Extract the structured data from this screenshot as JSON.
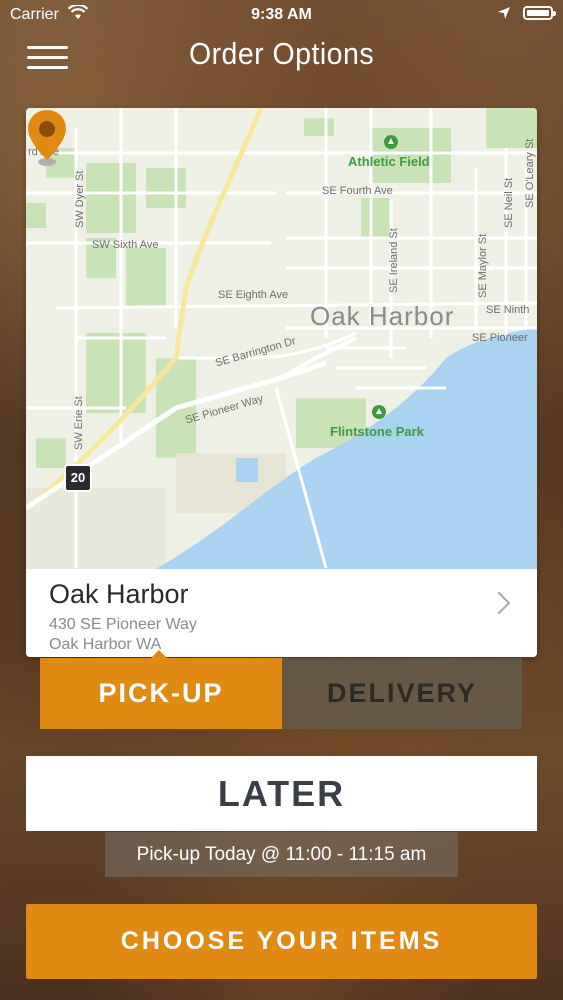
{
  "status_bar": {
    "carrier": "Carrier",
    "time": "9:38 AM",
    "battery_level": 0.95
  },
  "nav": {
    "title": "Order Options",
    "menu_icon": "hamburger-menu-icon"
  },
  "map": {
    "city_label": "Oak Harbor",
    "streets": [
      "rd Ave",
      "SW Dyer St",
      "SW Sixth Ave",
      "SE Fourth Ave",
      "SE Eighth Ave",
      "SE Barrington Dr",
      "SE Pioneer Way",
      "SE Ireland St",
      "SE Maylor St",
      "SE Neil St",
      "SE O'Leary St",
      "SE Ninth",
      "SE Pioneer",
      "SW Erie St"
    ],
    "parks": [
      "Athletic Field",
      "Flintstone Park"
    ],
    "route_shield": "20",
    "colors": {
      "water": "#a9d3f0",
      "park": "#c6e3b0",
      "road_major": "#f6e79a",
      "pin": "#e08a14"
    }
  },
  "location": {
    "name": "Oak Harbor",
    "address_line1": "430 SE Pioneer Way",
    "address_line2": "Oak Harbor WA"
  },
  "order_type": {
    "pickup_label": "PICK-UP",
    "delivery_label": "DELIVERY",
    "selected": "pickup"
  },
  "timing": {
    "later_label": "LATER",
    "pickup_time_text": "Pick-up Today @ 11:00 - 11:15 am"
  },
  "actions": {
    "choose_label": "CHOOSE YOUR ITEMS"
  },
  "colors": {
    "accent": "#e08a14",
    "text_dark": "#3a3f47"
  }
}
